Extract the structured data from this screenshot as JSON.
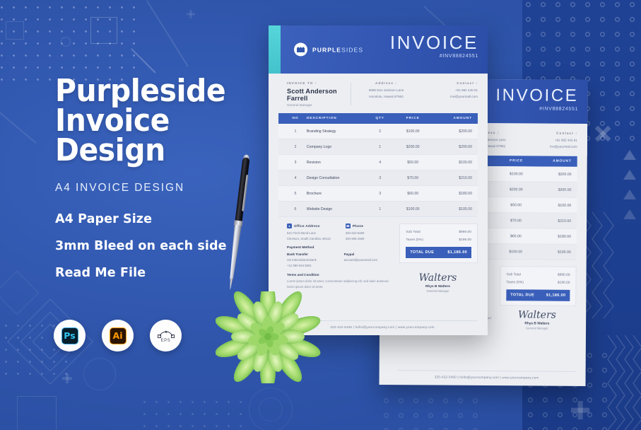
{
  "promo": {
    "headline_line1": "Purpleside",
    "headline_line2": "Invoice Design",
    "subheadline": "A4 INVOICE DESIGN",
    "features": [
      "A4 Paper Size",
      "3mm Bleed on each side",
      "Read Me File"
    ],
    "badges": [
      {
        "name": "photoshop",
        "label": "Ps",
        "caption": ""
      },
      {
        "name": "illustrator",
        "label": "Ai",
        "caption": ""
      },
      {
        "name": "eps",
        "label": "",
        "caption": "EPS"
      }
    ],
    "colors": {
      "background_blue": "#2e55a8",
      "panel_blue": "#1f4295",
      "header_blue": "#3458b4",
      "teal_accent": "#4ecdd4",
      "table_header_blue": "#3a5fba",
      "text_white": "#ffffff"
    }
  },
  "invoice": {
    "brand_bold": "PURPLE",
    "brand_light": "SIDES",
    "title": "INVOICE",
    "number": "#INV88824551",
    "bill_to_label": "INVOICE TO :",
    "client_name": "Scott Anderson Farrell",
    "client_role": "General Manager",
    "address_label": "Address :",
    "address_line1": "6985  Don Jackson Lane",
    "address_line2": "Honolulu, Hawaii 87962",
    "contact_label": "Contact :",
    "contact_phone": "+91 982 445 91",
    "contact_email": "invi@yourmail.com",
    "table": {
      "headers": [
        "NO",
        "DESCRIPTION",
        "QTY",
        "PRICE",
        "AMOUNT"
      ],
      "rows": [
        {
          "no": "1",
          "desc": "Branding Strategy",
          "qty": "2",
          "price": "$100.00",
          "amount": "$200.00"
        },
        {
          "no": "2",
          "desc": "Company Logo",
          "qty": "1",
          "price": "$200.00",
          "amount": "$200.00"
        },
        {
          "no": "3",
          "desc": "Revision",
          "qty": "4",
          "price": "$50.00",
          "amount": "$100.00"
        },
        {
          "no": "4",
          "desc": "Design Consultation",
          "qty": "3",
          "price": "$70.00",
          "amount": "$210.00"
        },
        {
          "no": "5",
          "desc": "Brochure",
          "qty": "3",
          "price": "$60.00",
          "amount": "$180.00"
        },
        {
          "no": "6",
          "desc": "Website Design",
          "qty": "1",
          "price": "$100.00",
          "amount": "$100.00"
        }
      ]
    },
    "totals": {
      "subtotal_label": "Sub Total",
      "subtotal_value": "$990.00",
      "tax_label": "Taxes (5%)",
      "tax_value": "$196.00",
      "due_label": "TOTAL DUE",
      "due_value": "$1,186.00"
    },
    "office_address_label": "Office Address",
    "office_address_line1": "541 Finch Bend Lane",
    "office_address_line2": "Clemson, South Carolina, 80112",
    "phone_label": "Phone",
    "phone_line1": "320-422-5460",
    "phone_line2": "320-366-1569",
    "payment_method_label": "Payment Method",
    "bank_transfer_label": "Bank Transfer",
    "bank_transfer_line1": "US International Bank",
    "bank_transfer_line2": "+12 080 916 5601",
    "paypal_label": "Paypal",
    "paypal_value": "account@youremail.com",
    "terms_label": "Terms and Condition",
    "terms_body": "Lorem ipsum dolor sit amet, consectetuer adipiscing elit, sed diam automod lorem ipsum dolor sit amet.",
    "signature_script": "Walters",
    "signature_name": "Rhys B Walters",
    "signature_role": "General Manager",
    "footer": "320-422-5460  |  hello@yourcompany.com |  www.yourcompany.com"
  }
}
